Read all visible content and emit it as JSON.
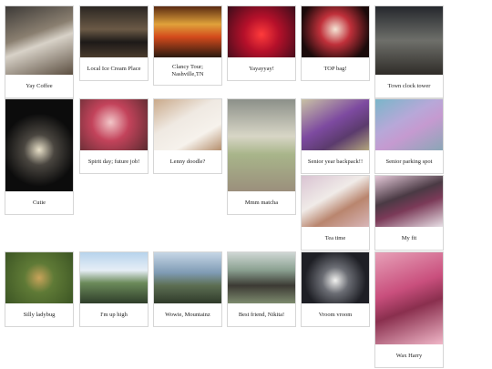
{
  "gallery": {
    "items": [
      {
        "caption": "Yay Coffee",
        "bg": "linear-gradient(160deg,#3d3a37 0%,#8a7f70 40%,#d8d2c8 55%,#5b4e40 100%)"
      },
      {
        "caption": "Local Ice Cream Place",
        "bg": "linear-gradient(180deg,#2b2622 0%,#6b5a46 45%,#1d1a18 70%,#4a3b2d 100%)"
      },
      {
        "caption": "Clancy Tour; Nashville,TN",
        "bg": "linear-gradient(180deg,#5a2a12 0%,#e0a23a 35%,#d34a1c 60%,#2a1a10 100%)"
      },
      {
        "caption": "Yayayyay!",
        "bg": "radial-gradient(circle at 50% 55%,#ff3b3b 0%,#b5102a 40%,#3a0d1a 100%)"
      },
      {
        "caption": "TOP bag!",
        "bg": "radial-gradient(circle at 50% 45%,#f5e6d6 0%,#c0303a 35%,#1a0a0a 80%)"
      },
      {
        "caption": "Town clock tower",
        "bg": "linear-gradient(180deg,#25282d 0%,#6e6f6a 50%,#2f2c28 100%)"
      },
      {
        "caption": "Cutie",
        "bg": "radial-gradient(circle at 50% 55%,#e8e0c8 0%,#4a4640 25%,#0c0c0c 60%)"
      },
      {
        "caption": "Spirit day; future job!",
        "bg": "radial-gradient(circle at 45% 45%,#f2c6c8 0%,#c3435b 40%,#5a2b2f 100%)"
      },
      {
        "caption": "Lenny doodle?",
        "bg": "linear-gradient(150deg,#c9a98a 0%,#efe9e2 40%,#f6f2ec 70%,#b58f6d 100%)"
      },
      {
        "caption": "Mmm matcha",
        "bg": "linear-gradient(180deg,#8c9089 0%,#d8d6c6 40%,#a8b58a 60%,#9b8f7c 100%)"
      },
      {
        "caption": "Senior year backpack!!",
        "bg": "linear-gradient(150deg,#c9c2a5 0%,#7d4aa0 45%,#5b3b6d 70%,#b3a57d 100%)"
      },
      {
        "caption": "Senior parking spot",
        "bg": "linear-gradient(150deg,#7ab6c9 0%,#b7a8d8 40%,#c59ad0 60%,#8aa6b6 100%)"
      },
      {
        "caption": "Tea time",
        "bg": "linear-gradient(150deg,#d9c3d2 0%,#f0ebe8 40%,#b9856e 65%,#d8b6b8 100%)"
      },
      {
        "caption": "My fit",
        "bg": "linear-gradient(160deg,#e4c8d8 0%,#4a3a44 40%,#7b3a58 60%,#e8e0e6 100%)"
      },
      {
        "caption": "Silly ladybug",
        "bg": "radial-gradient(circle at 50% 50%,#c9a35a 0%,#5f7a36 35%,#3c5524 100%)"
      },
      {
        "caption": "I'm up high",
        "bg": "linear-gradient(180deg,#b7d3ec 0%,#e6eef6 35%,#6b8a5a 60%,#2f3e2a 100%)"
      },
      {
        "caption": "Wowie, Mountainz",
        "bg": "linear-gradient(180deg,#c6d6e6 0%,#7f9bb4 40%,#5c6e52 65%,#2f3a2a 100%)"
      },
      {
        "caption": "Best friend, Nikita!",
        "bg": "linear-gradient(180deg,#cfd7d4 0%,#8aa090 35%,#3c3a34 65%,#7d8a6e 100%)"
      },
      {
        "caption": "Vroom vroom",
        "bg": "radial-gradient(circle at 50% 55%,#f2f2f0 0%,#6b6d74 30%,#1e1f25 70%)"
      },
      {
        "caption": "Wax Harry",
        "bg": "linear-gradient(160deg,#e7a1b8 0%,#c94f7d 40%,#8a2f4e 60%,#f0b7c8 100%)"
      }
    ]
  }
}
